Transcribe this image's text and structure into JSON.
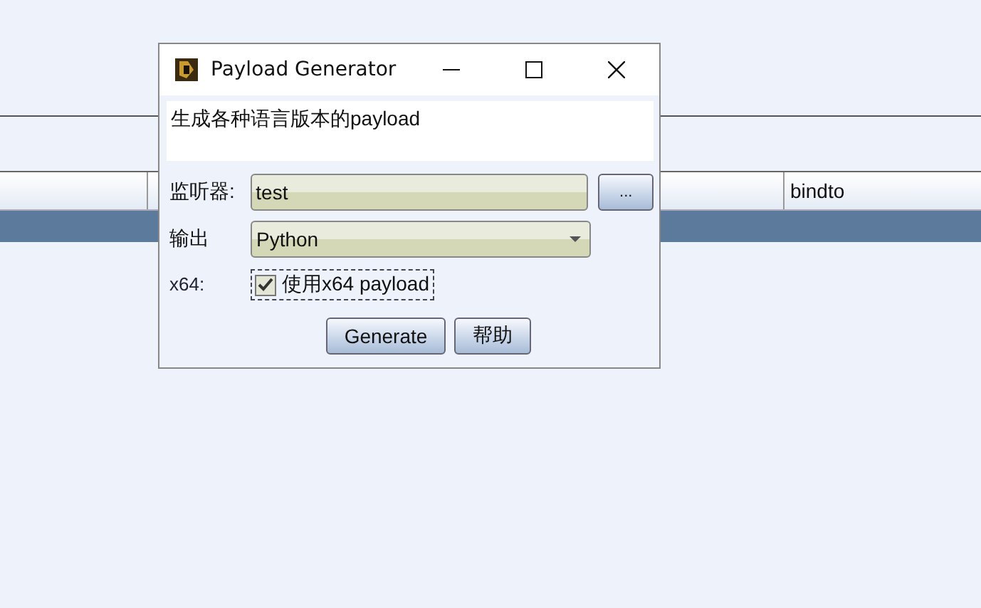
{
  "table": {
    "columns": [
      {
        "label": "bindto"
      }
    ],
    "rows": [
      {
        "selected": true
      }
    ]
  },
  "dialog": {
    "title": "Payload Generator",
    "description": "生成各种语言版本的payload",
    "listener": {
      "label": "监听器:",
      "value": "test",
      "button": "..."
    },
    "output": {
      "label": "输出",
      "value": "Python"
    },
    "x64": {
      "label": "x64:",
      "checkbox_label": "使用x64 payload",
      "checked": true
    },
    "buttons": [
      "Generate",
      "帮助"
    ]
  }
}
